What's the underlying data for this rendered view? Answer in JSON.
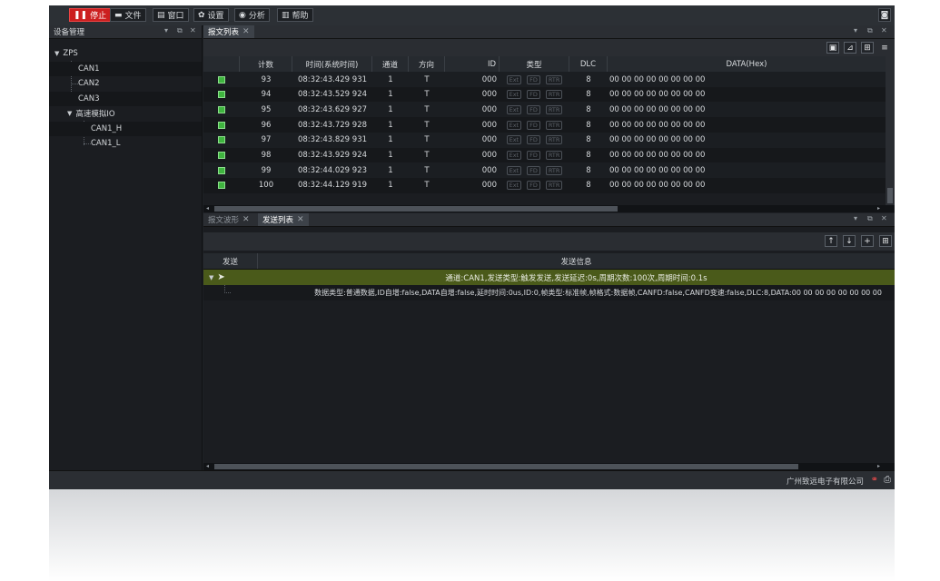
{
  "toolbar": {
    "stop": "停止",
    "file": "文件",
    "window": "窗口",
    "settings": "设置",
    "analysis": "分析",
    "help": "帮助"
  },
  "device_panel": {
    "title": "设备管理",
    "tree": {
      "root": "ZPS",
      "items": [
        "CAN1",
        "CAN2",
        "CAN3"
      ],
      "group": "高速模拟IO",
      "group_items": [
        "CAN1_H",
        "CAN1_L"
      ]
    }
  },
  "message_panel": {
    "tab": "报文列表",
    "columns": [
      "计数",
      "时间(系统时间)",
      "通道",
      "方向",
      "ID",
      "类型",
      "DLC",
      "DATA(Hex)"
    ],
    "type_tags": [
      "Ext",
      "FD",
      "RTR"
    ],
    "rows": [
      {
        "count": "93",
        "time": "08:32:43.429 931",
        "channel": "1",
        "dir": "T",
        "id": "000",
        "dlc": "8",
        "data": "00 00 00 00 00 00 00 00"
      },
      {
        "count": "94",
        "time": "08:32:43.529 924",
        "channel": "1",
        "dir": "T",
        "id": "000",
        "dlc": "8",
        "data": "00 00 00 00 00 00 00 00"
      },
      {
        "count": "95",
        "time": "08:32:43.629 927",
        "channel": "1",
        "dir": "T",
        "id": "000",
        "dlc": "8",
        "data": "00 00 00 00 00 00 00 00"
      },
      {
        "count": "96",
        "time": "08:32:43.729 928",
        "channel": "1",
        "dir": "T",
        "id": "000",
        "dlc": "8",
        "data": "00 00 00 00 00 00 00 00"
      },
      {
        "count": "97",
        "time": "08:32:43.829 931",
        "channel": "1",
        "dir": "T",
        "id": "000",
        "dlc": "8",
        "data": "00 00 00 00 00 00 00 00"
      },
      {
        "count": "98",
        "time": "08:32:43.929 924",
        "channel": "1",
        "dir": "T",
        "id": "000",
        "dlc": "8",
        "data": "00 00 00 00 00 00 00 00"
      },
      {
        "count": "99",
        "time": "08:32:44.029 923",
        "channel": "1",
        "dir": "T",
        "id": "000",
        "dlc": "8",
        "data": "00 00 00 00 00 00 00 00"
      },
      {
        "count": "100",
        "time": "08:32:44.129 919",
        "channel": "1",
        "dir": "T",
        "id": "000",
        "dlc": "8",
        "data": "00 00 00 00 00 00 00 00"
      }
    ]
  },
  "send_panel": {
    "tabs": [
      "报文波形",
      "发送列表"
    ],
    "columns": [
      "发送",
      "发送信息"
    ],
    "group_info": "通道:CAN1,发送类型:触发发送,发送延迟:0s,周期次数:100次,周期时间:0.1s",
    "detail_info": "数据类型:普通数据,ID自增:false,DATA自增:false,延时时间:0us,ID:0,帧类型:标准帧,帧格式:数据帧,CANFD:false,CANFD变速:false,DLC:8,DATA:00 00 00 00 00 00 00 00"
  },
  "status_bar": {
    "company": "广州致远电子有限公司"
  },
  "colors": {
    "stop_button": "#cc1f1f",
    "status_ok": "#3fb43f",
    "selected_row": "#4a5a1a"
  }
}
